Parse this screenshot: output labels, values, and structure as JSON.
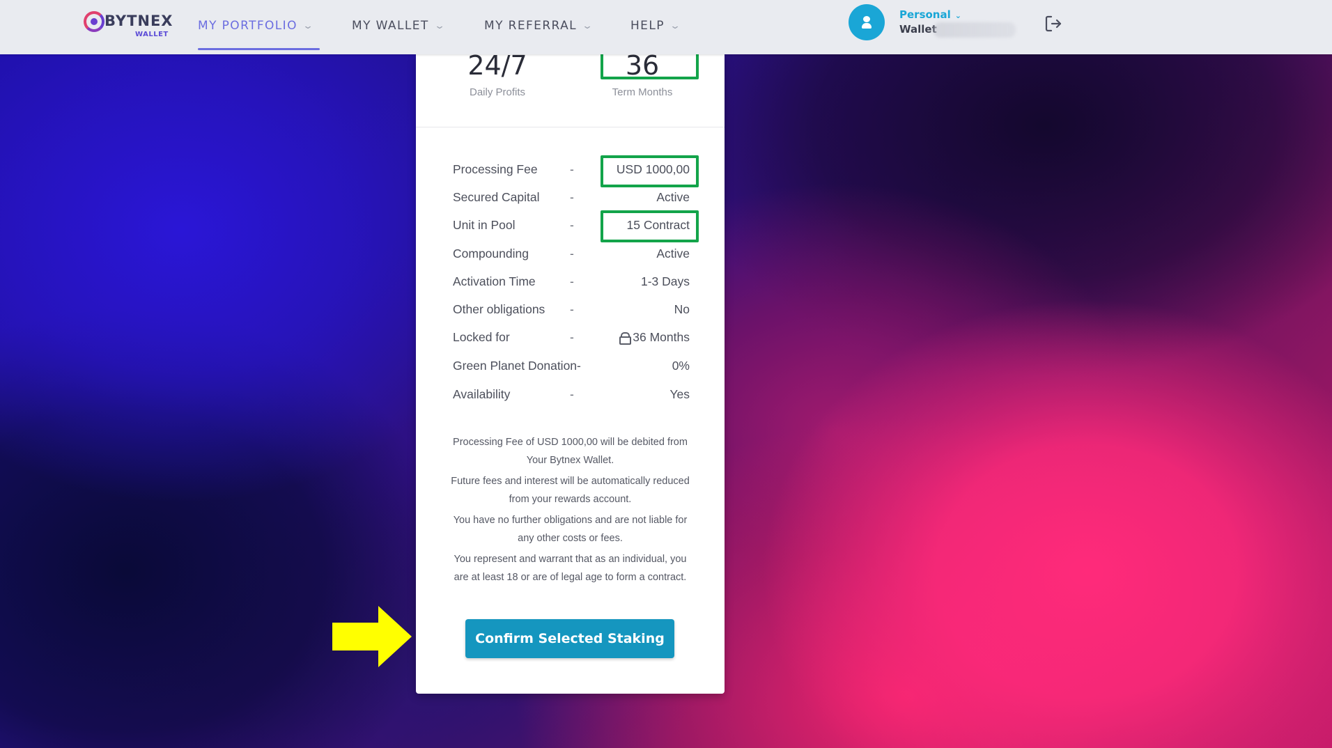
{
  "brand": {
    "name": "BYTNEX",
    "sub": "WALLET"
  },
  "nav": [
    {
      "label": "MY PORTFOLIO",
      "active": true
    },
    {
      "label": "MY WALLET",
      "active": false
    },
    {
      "label": "MY REFERRAL",
      "active": false
    },
    {
      "label": "HELP",
      "active": false
    }
  ],
  "account": {
    "type": "Personal",
    "wallet_label": "Wallet"
  },
  "stats": [
    {
      "value": "24/7",
      "label": "Daily Profits"
    },
    {
      "value": "36",
      "label": "Term Months"
    }
  ],
  "details": [
    {
      "key": "Processing Fee",
      "sep": "-",
      "value": "USD 1000,00"
    },
    {
      "key": "Secured Capital",
      "sep": "-",
      "value": "Active"
    },
    {
      "key": "Unit in Pool",
      "sep": "-",
      "value": "15 Contract"
    },
    {
      "key": "Compounding",
      "sep": "-",
      "value": "Active"
    },
    {
      "key": "Activation Time",
      "sep": "-",
      "value": "1-3 Days"
    },
    {
      "key": "Other obligations",
      "sep": "-",
      "value": "No"
    },
    {
      "key": "Locked for",
      "sep": "-",
      "value": "36 Months",
      "icon": "lock-icon"
    },
    {
      "key": "Green Planet Donation-",
      "sep": "",
      "value": "0%"
    },
    {
      "key": "Availability",
      "sep": "-",
      "value": "Yes"
    }
  ],
  "notes": [
    "Processing Fee of USD 1000,00 will be debited from Your Bytnex Wallet.",
    "Future fees and interest will be automatically reduced from your rewards account.",
    "You have no further obligations and are not liable for any other costs or fees.",
    "You represent and warrant that as an individual, you are at least 18 or are of legal age to form a contract."
  ],
  "confirm_button": "Confirm Selected Staking",
  "colors": {
    "accent": "#6b6de0",
    "button": "#1596bf",
    "highlight": "#13a44a",
    "annotation_arrow": "#ffff00"
  }
}
